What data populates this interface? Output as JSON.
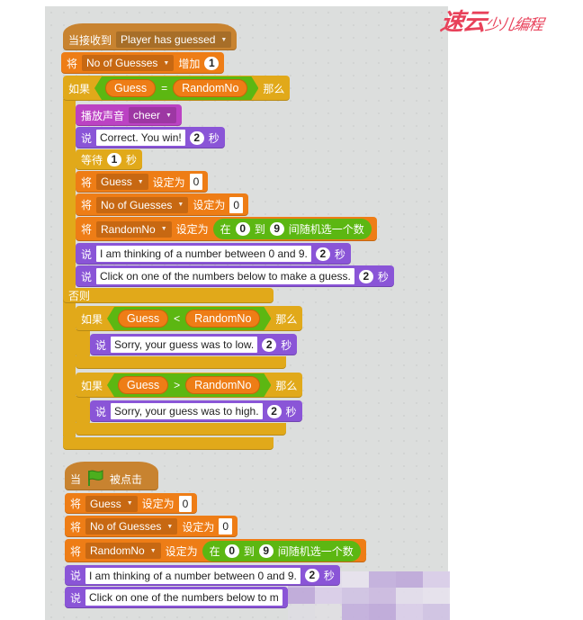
{
  "logo": {
    "main": "速云",
    "sub": "少儿编程"
  },
  "colors": {
    "events": "#c88330",
    "data": "#ee7d16",
    "control": "#e1a91a",
    "looks": "#8a55d7",
    "sound": "#bb42c3",
    "operators": "#5cb712"
  },
  "blocks": [
    {
      "cat": "events",
      "hat": true,
      "parts": [
        [
          "t",
          "当接收到"
        ],
        [
          "dd",
          "Player has guessed"
        ]
      ]
    },
    {
      "cat": "data",
      "parts": [
        [
          "t",
          "将"
        ],
        [
          "dd",
          "No of Guesses"
        ],
        [
          "t",
          "增加"
        ],
        [
          "num",
          "1"
        ]
      ]
    },
    {
      "cat": "control",
      "parts": [
        [
          "t",
          "如果"
        ],
        [
          "bool",
          [
            [
              "rep",
              "Guess"
            ],
            [
              "t",
              "="
            ],
            [
              "rep",
              "RandomNo"
            ]
          ]
        ],
        [
          "t",
          "那么"
        ]
      ]
    },
    {
      "cat": "sound",
      "parts": [
        [
          "t",
          "播放声音"
        ],
        [
          "dd",
          "cheer"
        ]
      ]
    },
    {
      "cat": "looks",
      "parts": [
        [
          "t",
          "说"
        ],
        [
          "in",
          "Correct. You win!"
        ],
        [
          "num",
          "2"
        ],
        [
          "t",
          "秒"
        ]
      ]
    },
    {
      "cat": "control",
      "parts": [
        [
          "t",
          "等待"
        ],
        [
          "num",
          "1"
        ],
        [
          "t",
          "秒"
        ]
      ]
    },
    {
      "cat": "data",
      "parts": [
        [
          "t",
          "将"
        ],
        [
          "dd",
          "Guess"
        ],
        [
          "t",
          "设定为"
        ],
        [
          "in",
          "0"
        ]
      ]
    },
    {
      "cat": "data",
      "parts": [
        [
          "t",
          "将"
        ],
        [
          "dd",
          "No of Guesses"
        ],
        [
          "t",
          "设定为"
        ],
        [
          "in",
          "0"
        ]
      ]
    },
    {
      "cat": "data",
      "parts": [
        [
          "t",
          "将"
        ],
        [
          "dd",
          "RandomNo"
        ],
        [
          "t",
          "设定为"
        ],
        [
          "rnd",
          [
            [
              "t",
              "在"
            ],
            [
              "num",
              "0"
            ],
            [
              "t",
              "到"
            ],
            [
              "num",
              "9"
            ],
            [
              "t",
              "间随机选一个数"
            ]
          ]
        ]
      ]
    },
    {
      "cat": "looks",
      "parts": [
        [
          "t",
          "说"
        ],
        [
          "in",
          "I am thinking of a number between 0 and 9."
        ],
        [
          "num",
          "2"
        ],
        [
          "t",
          "秒"
        ]
      ]
    },
    {
      "cat": "looks",
      "parts": [
        [
          "t",
          "说"
        ],
        [
          "in",
          "Click on one of the numbers below to make a guess."
        ],
        [
          "num",
          "2"
        ],
        [
          "t",
          "秒"
        ]
      ]
    },
    {
      "cat": "control",
      "parts": [
        [
          "t",
          "否则"
        ]
      ]
    },
    {
      "cat": "control",
      "parts": [
        [
          "t",
          "如果"
        ],
        [
          "bool",
          [
            [
              "rep",
              "Guess"
            ],
            [
              "t",
              "<"
            ],
            [
              "rep",
              "RandomNo"
            ]
          ]
        ],
        [
          "t",
          "那么"
        ]
      ]
    },
    {
      "cat": "looks",
      "parts": [
        [
          "t",
          "说"
        ],
        [
          "in",
          "Sorry, your guess was to low."
        ],
        [
          "num",
          "2"
        ],
        [
          "t",
          "秒"
        ]
      ]
    },
    {
      "cat": "control",
      "parts": [
        [
          "t",
          "如果"
        ],
        [
          "bool",
          [
            [
              "rep",
              "Guess"
            ],
            [
              "t",
              ">"
            ],
            [
              "rep",
              "RandomNo"
            ]
          ]
        ],
        [
          "t",
          "那么"
        ]
      ]
    },
    {
      "cat": "looks",
      "parts": [
        [
          "t",
          "说"
        ],
        [
          "in",
          "Sorry, your guess was to high."
        ],
        [
          "num",
          "2"
        ],
        [
          "t",
          "秒"
        ]
      ]
    },
    {
      "cat": "events",
      "hat": true,
      "parts": [
        [
          "t",
          "当"
        ],
        [
          "flag",
          "green-flag-icon"
        ],
        [
          "t",
          "被点击"
        ]
      ]
    },
    {
      "cat": "data",
      "parts": [
        [
          "t",
          "将"
        ],
        [
          "dd",
          "Guess"
        ],
        [
          "t",
          "设定为"
        ],
        [
          "in",
          "0"
        ]
      ]
    },
    {
      "cat": "data",
      "parts": [
        [
          "t",
          "将"
        ],
        [
          "dd",
          "No of Guesses"
        ],
        [
          "t",
          "设定为"
        ],
        [
          "in",
          "0"
        ]
      ]
    },
    {
      "cat": "data",
      "parts": [
        [
          "t",
          "将"
        ],
        [
          "dd",
          "RandomNo"
        ],
        [
          "t",
          "设定为"
        ],
        [
          "rnd",
          [
            [
              "t",
              "在"
            ],
            [
              "num",
              "0"
            ],
            [
              "t",
              "到"
            ],
            [
              "num",
              "9"
            ],
            [
              "t",
              "间随机选一个数"
            ]
          ]
        ]
      ]
    },
    {
      "cat": "looks",
      "parts": [
        [
          "t",
          "说"
        ],
        [
          "in",
          "I am thinking of a number between 0 and 9."
        ],
        [
          "num",
          "2"
        ],
        [
          "t",
          "秒"
        ]
      ]
    },
    {
      "cat": "looks",
      "parts": [
        [
          "t",
          "说"
        ],
        [
          "in",
          "Click on one of the numbers below to m"
        ]
      ]
    }
  ]
}
